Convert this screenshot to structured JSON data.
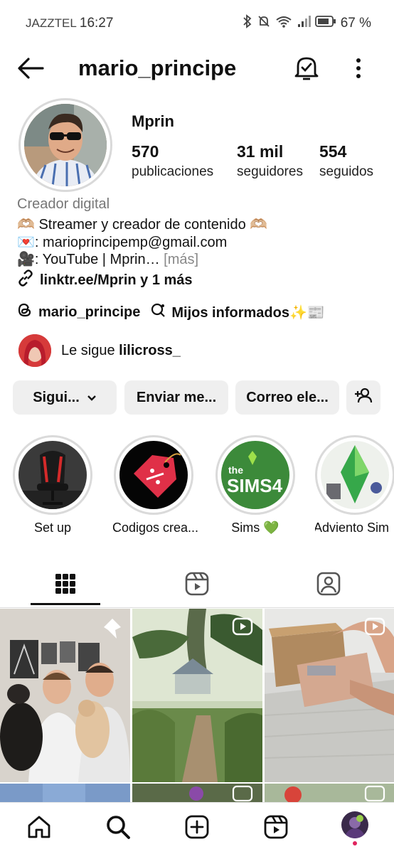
{
  "status_bar": {
    "carrier": "JAZZTEL",
    "time": "16:27",
    "battery": "67 %"
  },
  "header": {
    "username": "mario_principe"
  },
  "profile": {
    "display_name": "Mprin",
    "stats": [
      {
        "value": "570",
        "label": "publicaciones"
      },
      {
        "value": "31 mil",
        "label": "seguidores"
      },
      {
        "value": "554",
        "label": "seguidos"
      }
    ],
    "category": "Creador digital",
    "bio_line1": "🫶🏼 Streamer y creador de contenido 🫶🏼",
    "bio_line2": "💌: marioprincipemp@gmail.com",
    "bio_line3": "🎥: YouTube | Mprin…",
    "bio_more": " [más]",
    "link": "linktr.ee/Mprin y 1 más",
    "threads_handle": "mario_principe",
    "channel": "Mijos informados✨📰",
    "followed_by_prefix": "Le sigue ",
    "followed_by_user": "lilicross_"
  },
  "actions": {
    "following": "Sigui...",
    "message": "Enviar me...",
    "email": "Correo ele..."
  },
  "highlights": [
    {
      "label": "Set up"
    },
    {
      "label": "Codigos crea..."
    },
    {
      "label": "Sims 💚"
    },
    {
      "label": "Adviento Sim"
    }
  ],
  "icons": {
    "back": "arrow-left-icon",
    "bell": "bell-check-icon",
    "menu": "more-vertical-icon",
    "grid": "grid-icon",
    "reels": "reels-icon",
    "tagged": "tagged-icon",
    "home": "home-icon",
    "search": "search-icon",
    "create": "plus-square-icon",
    "profile": "avatar-icon"
  },
  "colors": {
    "accent": "#111111",
    "button_bg": "#efefef",
    "notification_dot": "#e0245e"
  }
}
